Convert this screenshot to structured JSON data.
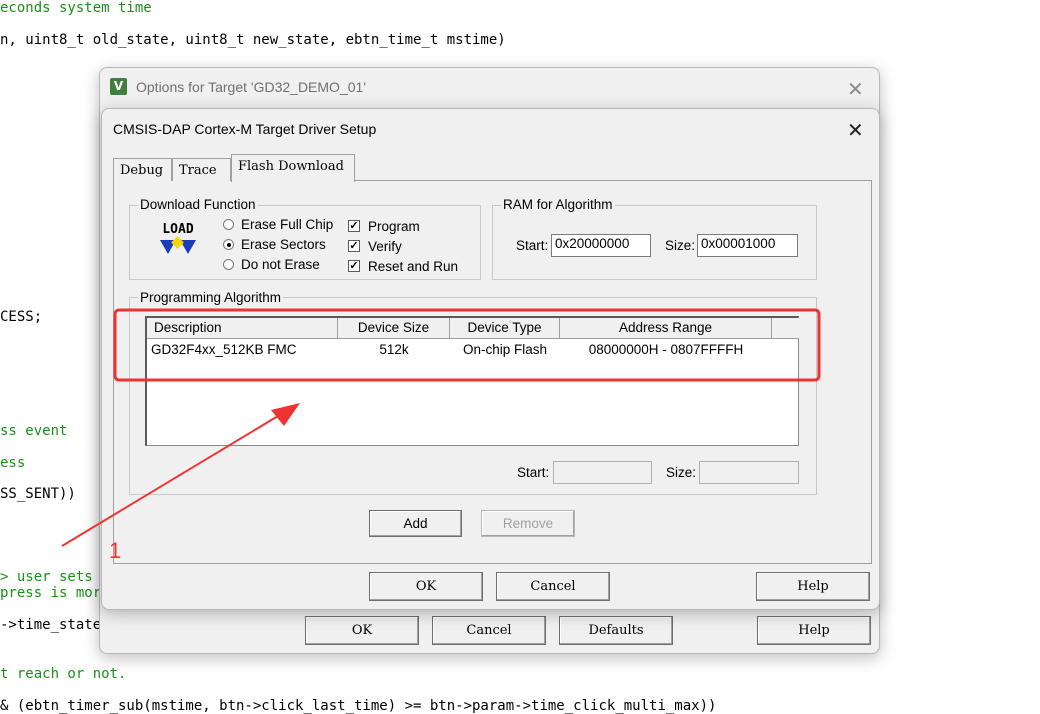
{
  "editor": {
    "lines": [
      {
        "text": "econds system time",
        "comment": true
      },
      {
        "text": "n, uint8_t old_state, uint8_t new_state, ebtn_time_t mstime)",
        "comment": false
      },
      {
        "text": "CESS;",
        "comment": false
      },
      {
        "text": "ss event",
        "comment": true
      },
      {
        "text": "ess",
        "comment": true
      },
      {
        "text": "SS_SENT))",
        "comment": false
      },
      {
        "text": "> user sets",
        "comment": true
      },
      {
        "text": "press is mor",
        "comment": true
      },
      {
        "text": "->time_state",
        "comment": false
      },
      {
        "text": "t reach or not.",
        "comment": true
      },
      {
        "text": "& (ebtn_timer_sub(mstime, btn->click_last_time) >= btn->param->time_click_multi_max))",
        "comment": false
      }
    ]
  },
  "options_dialog": {
    "title": "Options for Target 'GD32_DEMO_01'",
    "close_glyph": "✕",
    "buttons": {
      "ok": "OK",
      "cancel": "Cancel",
      "defaults": "Defaults",
      "help": "Help"
    }
  },
  "driver_dialog": {
    "title": "CMSIS-DAP Cortex-M Target Driver Setup",
    "close_glyph": "✕",
    "tabs": [
      {
        "label": "Debug",
        "active": false
      },
      {
        "label": "Trace",
        "active": false
      },
      {
        "label": "Flash Download",
        "active": true
      }
    ],
    "download_function": {
      "label": "Download Function",
      "load_icon_text": "LOAD",
      "radios": [
        {
          "label": "Erase Full Chip",
          "selected": false
        },
        {
          "label": "Erase Sectors",
          "selected": true
        },
        {
          "label": "Do not Erase",
          "selected": false
        }
      ],
      "checkboxes": [
        {
          "label": "Program",
          "checked": true
        },
        {
          "label": "Verify",
          "checked": true
        },
        {
          "label": "Reset and Run",
          "checked": true
        }
      ]
    },
    "ram_for_algorithm": {
      "label": "RAM for Algorithm",
      "start_label": "Start:",
      "start_value": "0x20000000",
      "size_label": "Size:",
      "size_value": "0x00001000"
    },
    "programming_algorithm": {
      "label": "Programming Algorithm",
      "columns": [
        "Description",
        "Device Size",
        "Device Type",
        "Address Range"
      ],
      "rows": [
        {
          "description": "GD32F4xx_512KB FMC",
          "device_size": "512k",
          "device_type": "On-chip Flash",
          "address_range": "08000000H - 0807FFFFH"
        }
      ],
      "start_label": "Start:",
      "start_value": "",
      "size_label": "Size:",
      "size_value": ""
    },
    "buttons": {
      "add": "Add",
      "remove": "Remove",
      "ok": "OK",
      "cancel": "Cancel",
      "help": "Help"
    }
  },
  "annotation": {
    "number": "1",
    "color": "#ee3333"
  }
}
